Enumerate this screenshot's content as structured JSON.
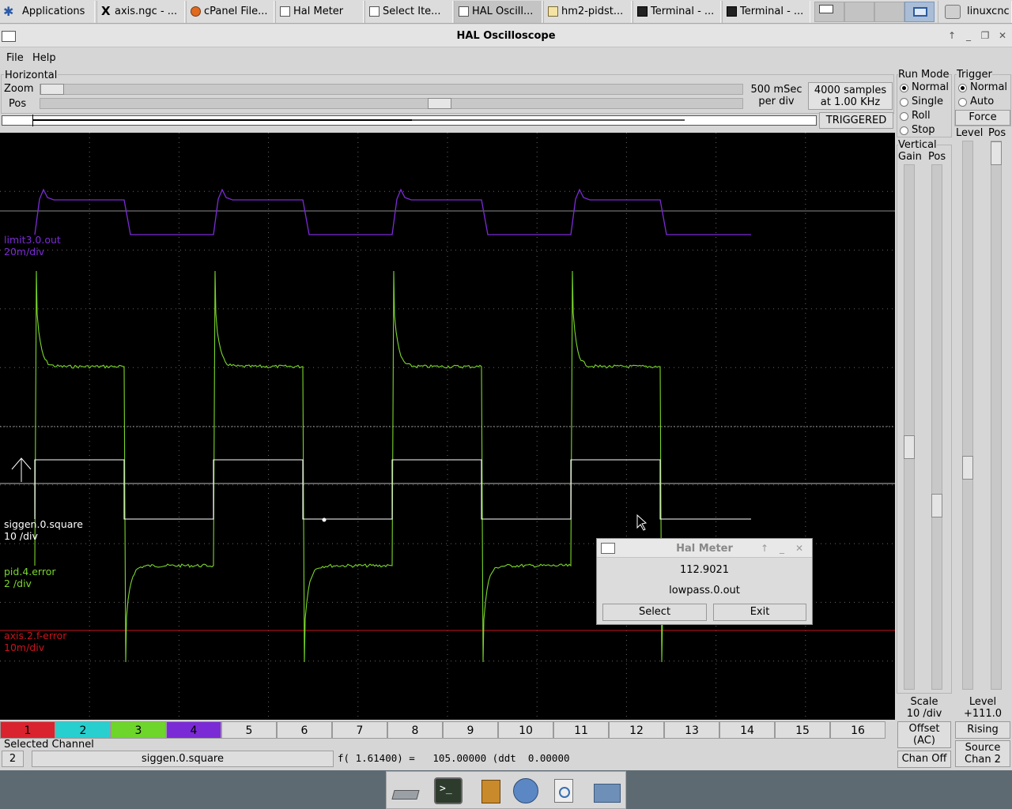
{
  "taskbar": {
    "apps_label": "Applications",
    "items": [
      {
        "label": "axis.ngc - ...",
        "icon": "x-icon"
      },
      {
        "label": "cPanel File...",
        "icon": "firefox-icon"
      },
      {
        "label": "Hal Meter",
        "icon": "window-icon"
      },
      {
        "label": "Select Ite...",
        "icon": "window-icon"
      },
      {
        "label": "HAL Oscill...",
        "icon": "window-icon"
      },
      {
        "label": "hm2-pidst...",
        "icon": "editor-icon"
      },
      {
        "label": "Terminal - ...",
        "icon": "terminal-icon"
      },
      {
        "label": "Terminal - ...",
        "icon": "terminal-icon"
      }
    ],
    "user": "linuxcnc"
  },
  "window": {
    "title": "HAL Oscilloscope"
  },
  "menu": {
    "file": "File",
    "help": "Help"
  },
  "horizontal": {
    "title": "Horizontal",
    "zoom_label": "Zoom",
    "pos_label": "Pos",
    "time_per_div_1": "500 mSec",
    "time_per_div_2": "per div",
    "samples_1": "4000 samples",
    "samples_2": "at 1.00 KHz",
    "status": "TRIGGERED",
    "zoom_level": 0.0,
    "pos_level": 0.57
  },
  "run_mode": {
    "title": "Run Mode",
    "options": [
      "Normal",
      "Single",
      "Roll",
      "Stop"
    ],
    "selected": "Normal"
  },
  "trigger": {
    "title": "Trigger",
    "options": [
      "Normal",
      "Auto"
    ],
    "selected": "Normal",
    "force_label": "Force",
    "level_label": "Level",
    "pos_label": "Pos",
    "level_title": "Level",
    "level_value": "+111.0",
    "edge_button": "Rising",
    "source_1": "Source",
    "source_2": "Chan  2"
  },
  "vertical": {
    "title": "Vertical",
    "gain_label": "Gain",
    "pos_label": "Pos",
    "scale_label": "Scale",
    "scale_value": "10 /div",
    "offset_1": "Offset",
    "offset_2": "(AC)",
    "chan_off": "Chan Off"
  },
  "traces": [
    {
      "name": "limit3.0.out",
      "scale": "20m/div",
      "color": "#7b2bd6"
    },
    {
      "name": "siggen.0.square",
      "scale": "10 /div",
      "color": "#ffffff"
    },
    {
      "name": "pid.4.error",
      "scale": "2 /div",
      "color": "#7bd62b"
    },
    {
      "name": "axis.2.f-error",
      "scale": "10m/div",
      "color": "#c8141e"
    }
  ],
  "channels": [
    {
      "label": "1",
      "color": "#d9232e"
    },
    {
      "label": "2",
      "color": "#27cfcf"
    },
    {
      "label": "3",
      "color": "#6ed62b"
    },
    {
      "label": "4",
      "color": "#7b2bd6"
    },
    {
      "label": "5",
      "color": ""
    },
    {
      "label": "6",
      "color": ""
    },
    {
      "label": "7",
      "color": ""
    },
    {
      "label": "8",
      "color": ""
    },
    {
      "label": "9",
      "color": ""
    },
    {
      "label": "10",
      "color": ""
    },
    {
      "label": "11",
      "color": ""
    },
    {
      "label": "12",
      "color": ""
    },
    {
      "label": "13",
      "color": ""
    },
    {
      "label": "14",
      "color": ""
    },
    {
      "label": "15",
      "color": ""
    },
    {
      "label": "16",
      "color": ""
    }
  ],
  "selected_channel": {
    "title": "Selected Channel",
    "number": "2",
    "name": "siggen.0.square",
    "readout": "f( 1.61400) =   105.00000 (ddt  0.00000"
  },
  "hal_meter": {
    "title": "Hal Meter",
    "value": "112.9021",
    "pin": "lowpass.0.out",
    "select_label": "Select",
    "exit_label": "Exit"
  },
  "dock": {
    "icons": [
      "drive-icon",
      "terminal-icon",
      "files-cabinet-icon",
      "web-browser-icon",
      "search-icon",
      "folder-icon"
    ]
  }
}
